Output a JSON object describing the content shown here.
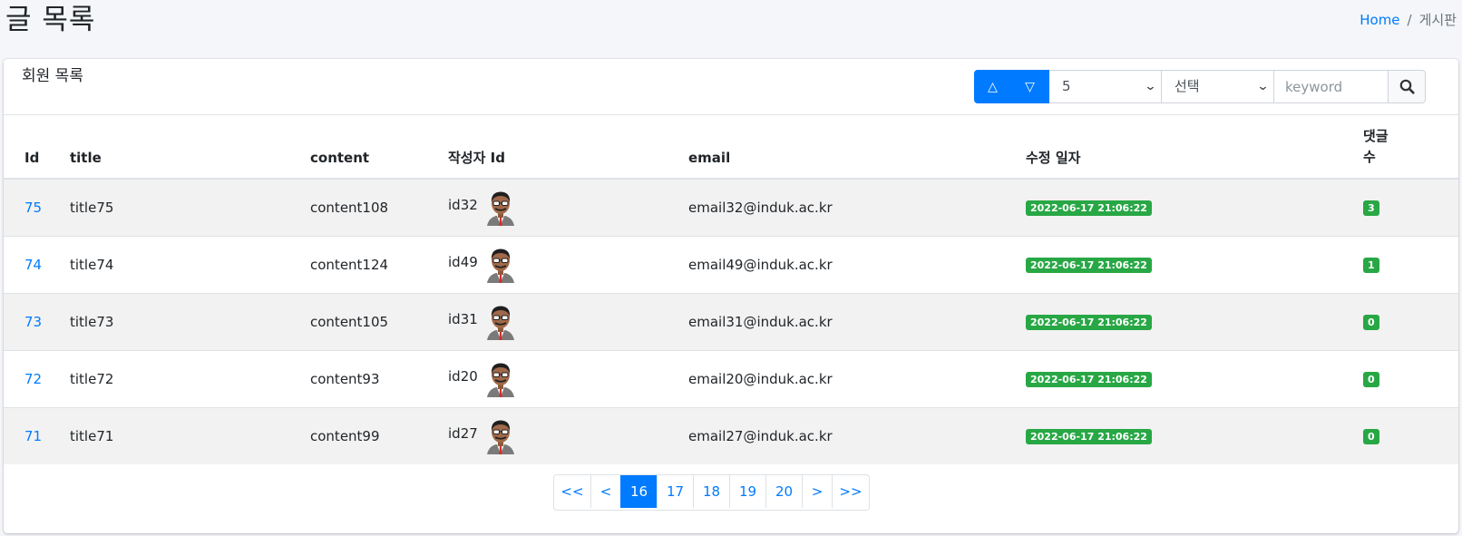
{
  "page": {
    "title": "글 목록",
    "breadcrumb": {
      "home": "Home",
      "separator": "/",
      "current": "게시판"
    }
  },
  "card": {
    "title": "회원 목록",
    "tools": {
      "sort_asc_icon": "△",
      "sort_desc_icon": "▽",
      "page_size": "5",
      "search_type": "선택",
      "keyword_placeholder": "keyword",
      "keyword_value": ""
    }
  },
  "table": {
    "headers": {
      "id": "Id",
      "title": "title",
      "content": "content",
      "writer": "작성자 Id",
      "email": "email",
      "modified": "수정 일자",
      "comments": "댓글 수"
    },
    "rows": [
      {
        "id": "75",
        "title": "title75",
        "content": "content108",
        "writer": "id32",
        "email": "email32@induk.ac.kr",
        "modified": "2022-06-17 21:06:22",
        "comments": "3"
      },
      {
        "id": "74",
        "title": "title74",
        "content": "content124",
        "writer": "id49",
        "email": "email49@induk.ac.kr",
        "modified": "2022-06-17 21:06:22",
        "comments": "1"
      },
      {
        "id": "73",
        "title": "title73",
        "content": "content105",
        "writer": "id31",
        "email": "email31@induk.ac.kr",
        "modified": "2022-06-17 21:06:22",
        "comments": "0"
      },
      {
        "id": "72",
        "title": "title72",
        "content": "content93",
        "writer": "id20",
        "email": "email20@induk.ac.kr",
        "modified": "2022-06-17 21:06:22",
        "comments": "0"
      },
      {
        "id": "71",
        "title": "title71",
        "content": "content99",
        "writer": "id27",
        "email": "email27@induk.ac.kr",
        "modified": "2022-06-17 21:06:22",
        "comments": "0"
      }
    ]
  },
  "pagination": {
    "first": "<<",
    "prev": "<",
    "pages": [
      "16",
      "17",
      "18",
      "19",
      "20"
    ],
    "active": "16",
    "next": ">",
    "last": ">>"
  },
  "colors": {
    "primary": "#007bff",
    "badge_green": "#28a745",
    "stripe": "#f2f2f2",
    "page_bg": "#f4f6f9"
  },
  "icons": {
    "sort_asc": "triangle-up-outline-icon",
    "sort_desc": "triangle-down-outline-icon",
    "select_chevron": "chevron-down-icon",
    "search": "magnifier-icon",
    "avatar": "man-with-glasses-avatar"
  }
}
